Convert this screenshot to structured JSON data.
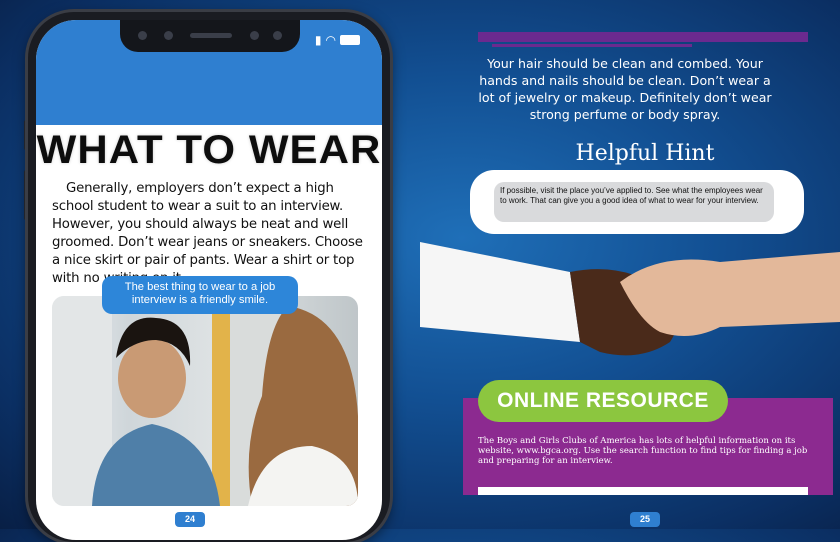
{
  "left_page": {
    "title": "WHAT TO WEAR",
    "body": "Generally, employers don’t expect a high school student to wear a suit to an interview. However, you should always be neat and well groomed. Don’t wear jeans or sneakers. Choose a nice skirt or pair of pants. Wear a shirt or top with no writing on it.",
    "bubble": "The best thing to wear to a job interview is a friendly smile.",
    "page_number": "24"
  },
  "right_page": {
    "paragraph": "Your hair should be clean and combed. Your hands and nails should be clean. Don’t wear a lot of jewelry or makeup. Definitely don’t wear strong perfume or body spray.",
    "hint_title": "Helpful Hint",
    "hint_text": "If possible, visit the place you’ve applied to. See what the employees wear to work. That can give you a good idea of what to wear for your interview.",
    "resource_title": "ONLINE RESOURCE",
    "resource_text": "The Boys and Girls Clubs of America has lots of helpful information on its website, www.bgca.org. Use the search function to find tips for finding a job and preparing for an interview.",
    "page_number": "25"
  },
  "colors": {
    "accent_blue": "#2f7fd0",
    "purple": "#8c2a90",
    "green": "#8cc63f"
  }
}
